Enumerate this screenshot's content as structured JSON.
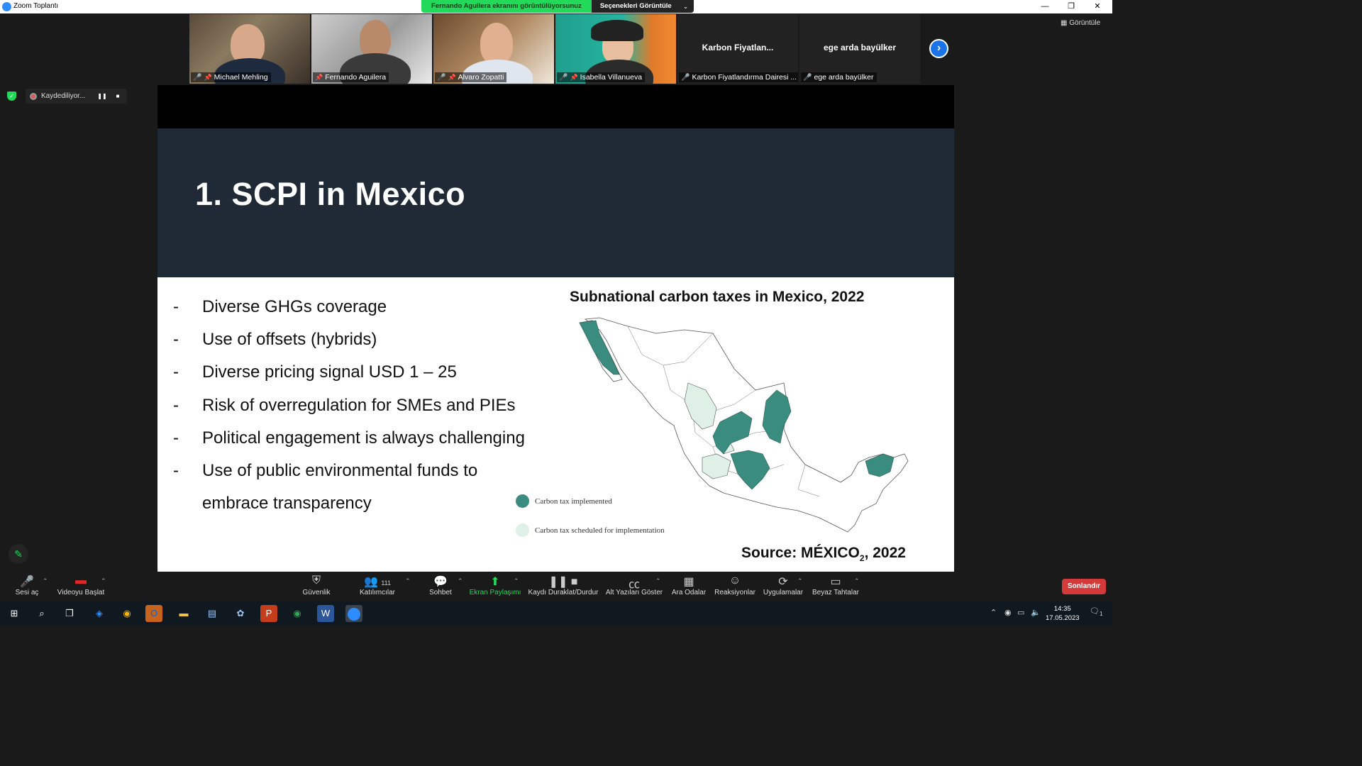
{
  "window": {
    "title": "Zoom Toplantı",
    "minimize": "—",
    "restore": "❐",
    "close": "✕"
  },
  "share_banner": {
    "message": "Fernando Aguilera ekranını görüntülüyorsunuz",
    "options": "Seçenekleri Görüntüle",
    "chevron": "⌄"
  },
  "gallery": {
    "participants": [
      {
        "name": "Michael Mehling"
      },
      {
        "name": "Fernando Aguilera"
      },
      {
        "name": "Alvaro Zopatti"
      },
      {
        "name": "Isabella Villanueva"
      },
      {
        "name": "Karbon Fiyatlandırma Dairesi ...",
        "display": "Karbon  Fiyatlan..."
      },
      {
        "name": "ege arda bayülker",
        "display": "ege arda bayülker"
      }
    ],
    "view_label": "Görüntüle"
  },
  "recording": {
    "label": "Kaydediliyor...",
    "pause": "❚❚",
    "stop": "■"
  },
  "slide": {
    "title": "1. SCPI in Mexico",
    "bullets": [
      "Diverse GHGs coverage",
      "Use of offsets (hybrids)",
      "Diverse pricing signal USD 1 – 25",
      "Risk of overregulation for SMEs and PIEs",
      "Political engagement is always challenging",
      "Use of public environmental funds to",
      "embrace transparency"
    ],
    "dash": "-",
    "map_title": "Subnational carbon taxes in Mexico, 2022",
    "legend": [
      {
        "label": "Carbon tax implemented",
        "color": "#3a8c7e"
      },
      {
        "label": "Carbon tax scheduled for implementation",
        "color": "#dff0e6"
      }
    ],
    "source_prefix": "Source: MÉXICO",
    "source_sub": "2",
    "source_suffix": ", 2022"
  },
  "toolbar": {
    "mute": "Sesi aç",
    "video": "Videoyu Başlat",
    "security": "Güvenlik",
    "participants": "Katılımcılar",
    "participants_count": "111",
    "chat": "Sohbet",
    "share": "Ekran Paylaşımı",
    "record": "Kaydı Duraklat/Durdur",
    "captions": "Alt Yazıları Göster",
    "breakout": "Ara Odalar",
    "reactions": "Reaksiyonlar",
    "apps": "Uygulamalar",
    "whiteboard": "Beyaz Tahtalar",
    "end": "Sonlandır"
  },
  "taskbar": {
    "time": "14:35",
    "date": "17.05.2023",
    "notifications": "1"
  }
}
